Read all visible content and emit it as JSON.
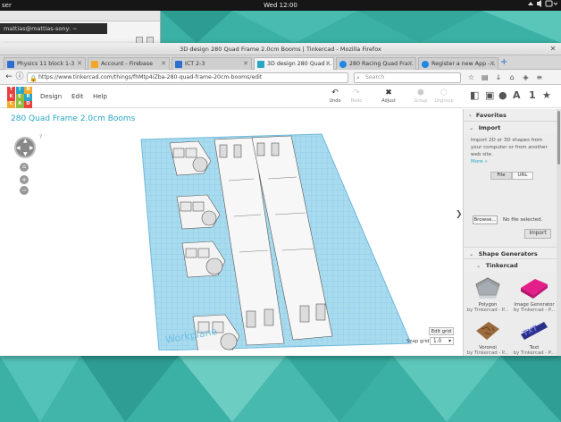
{
  "topbar": {
    "left_text": "ser",
    "clock": "Wed 12:00"
  },
  "bg_window": {
    "row1": "mattias@mattias-sony: ~",
    "row2": "mattias@mattias-sony: ~"
  },
  "firefox": {
    "window_title": "3D design 280 Quad Frame 2.0cm Booms | Tinkercad - Mozilla Firefox",
    "tabs": [
      {
        "label": "Physics 11 block 1-3",
        "favicon_color": "#2d6fd0"
      },
      {
        "label": "Account - Firebase",
        "favicon_color": "#f5a623"
      },
      {
        "label": "ICT 2-3",
        "favicon_color": "#2d6fd0"
      },
      {
        "label": "3D design 280 Quad ...",
        "favicon_color": "#2aa7c5"
      },
      {
        "label": "280 Racing Quad Fra...",
        "favicon_color": "#1e88e5"
      },
      {
        "label": "Register a new App -...",
        "favicon_color": "#1e88e5"
      }
    ],
    "new_tab": "+",
    "url": "https://www.tinkercad.com/things/fhMtp4iZba-280-quad-frame-20cm-booms/edit",
    "search_placeholder": "Search"
  },
  "tinkercad": {
    "logo_letters": [
      "T",
      "I",
      "N",
      "K",
      "E",
      "R",
      "C",
      "A",
      "D"
    ],
    "logo_colors": [
      "#e8423f",
      "#2aa7c5",
      "#f4a92c",
      "#e8423f",
      "#8cbf3f",
      "#2aa7c5",
      "#f4a92c",
      "#8cbf3f",
      "#e8423f"
    ],
    "menu": [
      "Design",
      "Edit",
      "Help"
    ],
    "toolbar": {
      "undo": "Undo",
      "redo": "Redo",
      "adjust": "Adjust",
      "group": "Group",
      "ungroup": "Ungroup"
    },
    "right_tools": [
      "A",
      "1",
      "★"
    ],
    "design_title": "280 Quad Frame 2.0cm Booms",
    "help_q": "?",
    "workplane_label": "Workplane",
    "edit_grid": "Edit grid",
    "snap_grid_label": "Snap grid",
    "snap_grid_value": "1.0",
    "sidebar_toggle": "❯",
    "panel": {
      "favorites": "Favorites",
      "import": "Import",
      "import_desc": "Import 2D or 3D shapes from your computer or from another web site.",
      "more": "More »",
      "file_tab": "File",
      "url_tab": "URL",
      "browse": "Browse...",
      "no_file": "No file selected.",
      "import_button": "Import",
      "shape_generators": "Shape Generators",
      "tinkercad": "Tinkercad",
      "generators": [
        {
          "name": "Polygon",
          "by": "by Tinkercad - P..."
        },
        {
          "name": "Image Generator",
          "by": "by Tinkercad - P..."
        },
        {
          "name": "Voronoi",
          "by": "by Tinkercad - P..."
        },
        {
          "name": "Text",
          "by": "by Tinkercad - P..."
        }
      ]
    }
  }
}
